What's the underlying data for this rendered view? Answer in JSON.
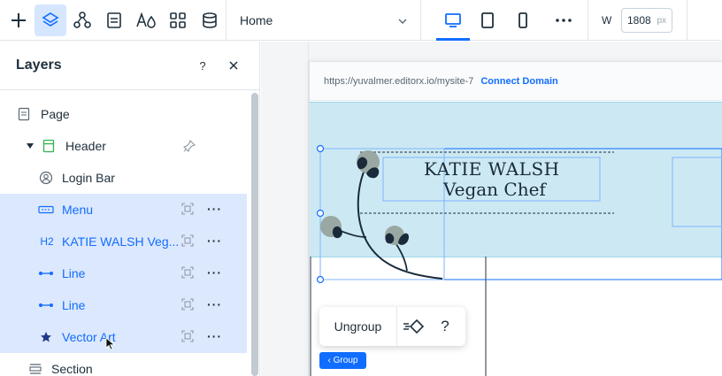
{
  "toolbar": {
    "page_name": "Home",
    "width_label": "W",
    "width_value": "1808",
    "width_unit": "px",
    "icons": [
      "add-icon",
      "layers-icon",
      "connections-icon",
      "pages-icon",
      "theme-icon",
      "apps-icon",
      "cms-icon",
      "desktop-icon",
      "tablet-icon",
      "mobile-icon",
      "more-icon",
      "chevron-down-icon"
    ],
    "active_color": "#116dff"
  },
  "layers_panel": {
    "title": "Layers",
    "help": "?",
    "close": "✕",
    "items": [
      {
        "label": "Page",
        "icon": "page-icon",
        "selected": false
      },
      {
        "label": "Header",
        "icon": "header-icon",
        "selected": false
      },
      {
        "label": "Login Bar",
        "icon": "login-icon",
        "selected": false
      },
      {
        "label": "Menu",
        "icon": "menu-icon",
        "selected": true
      },
      {
        "label": "KATIE WALSH Veg...",
        "icon_text": "H2",
        "icon": "heading-icon",
        "selected": true
      },
      {
        "label": "Line",
        "icon": "line-icon",
        "selected": true
      },
      {
        "label": "Line",
        "icon": "line-icon",
        "selected": true
      },
      {
        "label": "Vector Art",
        "icon": "star-icon",
        "selected": true
      },
      {
        "label": "Section",
        "icon": "section-icon",
        "selected": false
      }
    ],
    "more": "···"
  },
  "canvas": {
    "url": "https://yuvalmer.editorx.io/mysite-7",
    "connect_domain": "Connect Domain",
    "site_title_line1": "KATIE WALSH",
    "site_title_line2": "Vegan Chef",
    "header_color": "#cce9f3"
  },
  "group_toolbar": {
    "ungroup": "Ungroup",
    "help": "?",
    "group_tag": "‹ Group"
  }
}
